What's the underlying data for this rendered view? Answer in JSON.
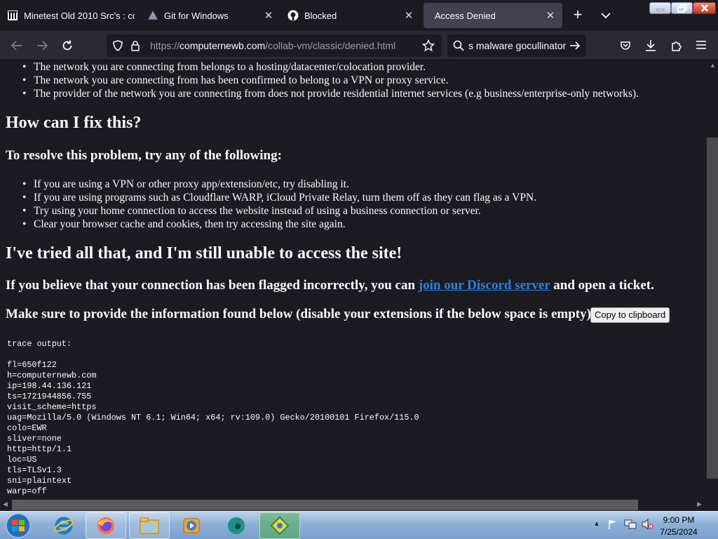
{
  "tabs": [
    {
      "title": "Minetest Old 2010 Src's : cc",
      "favicon": "archive-icon"
    },
    {
      "title": "Git for Windows",
      "favicon": "git-icon"
    },
    {
      "title": "Blocked",
      "favicon": "github-icon"
    },
    {
      "title": "Access Denied",
      "favicon": "none",
      "active": true
    }
  ],
  "navbar": {
    "url_prefix": "https://",
    "url_host": "computernewb.com",
    "url_path": "/collab-vm/classic/denied.html",
    "search_text": "s malware gocullinator"
  },
  "page": {
    "reasons": [
      "The network you are connecting from belongs to a hosting/datacenter/colocation provider.",
      "The network you are connecting from has been confirmed to belong to a VPN or proxy service.",
      "The provider of the network you are connecting from does not provide residential internet services (e.g business/enterprise-only networks)."
    ],
    "fix_heading": "How can I fix this?",
    "resolve_heading": "To resolve this problem, try any of the following:",
    "fixes": [
      "If you are using a VPN or other proxy app/extension/etc, try disabling it.",
      "If you are using programs such as Cloudflare WARP, iCloud Private Relay, turn them off as they can flag as a VPN.",
      "Try using your home connection to access the website instead of using a business connection or server.",
      "Clear your browser cache and cookies, then try accessing the site again."
    ],
    "tried_heading": "I've tried all that, and I'm still unable to access the site!",
    "flagged_before": "If you believe that your connection has been flagged incorrectly, you can ",
    "flagged_link": "join our Discord server",
    "flagged_after": " and open a ticket.",
    "provide_text": "Make sure to provide the information found below (disable your extensions if the below space is empty):",
    "copy_button": "Copy to clipboard",
    "trace_title": "trace output:",
    "trace_lines": [
      "fl=650f122",
      "h=computernewb.com",
      "ip=198.44.136.121",
      "ts=1721944856.755",
      "visit_scheme=https",
      "uag=Mozilla/5.0 (Windows NT 6.1; Win64; x64; rv:109.0) Gecko/20100101 Firefox/115.0",
      "colo=EWR",
      "sliver=none",
      "http=http/1.1",
      "loc=US",
      "tls=TLSv1.3",
      "sni=plaintext",
      "warp=off"
    ]
  },
  "taskbar": {
    "items": [
      "internet-explorer-icon",
      "firefox-icon",
      "file-explorer-icon",
      "media-player-icon",
      "app-icon",
      "app-icon"
    ],
    "time": "9:00 PM",
    "date": "7/25/2024"
  }
}
